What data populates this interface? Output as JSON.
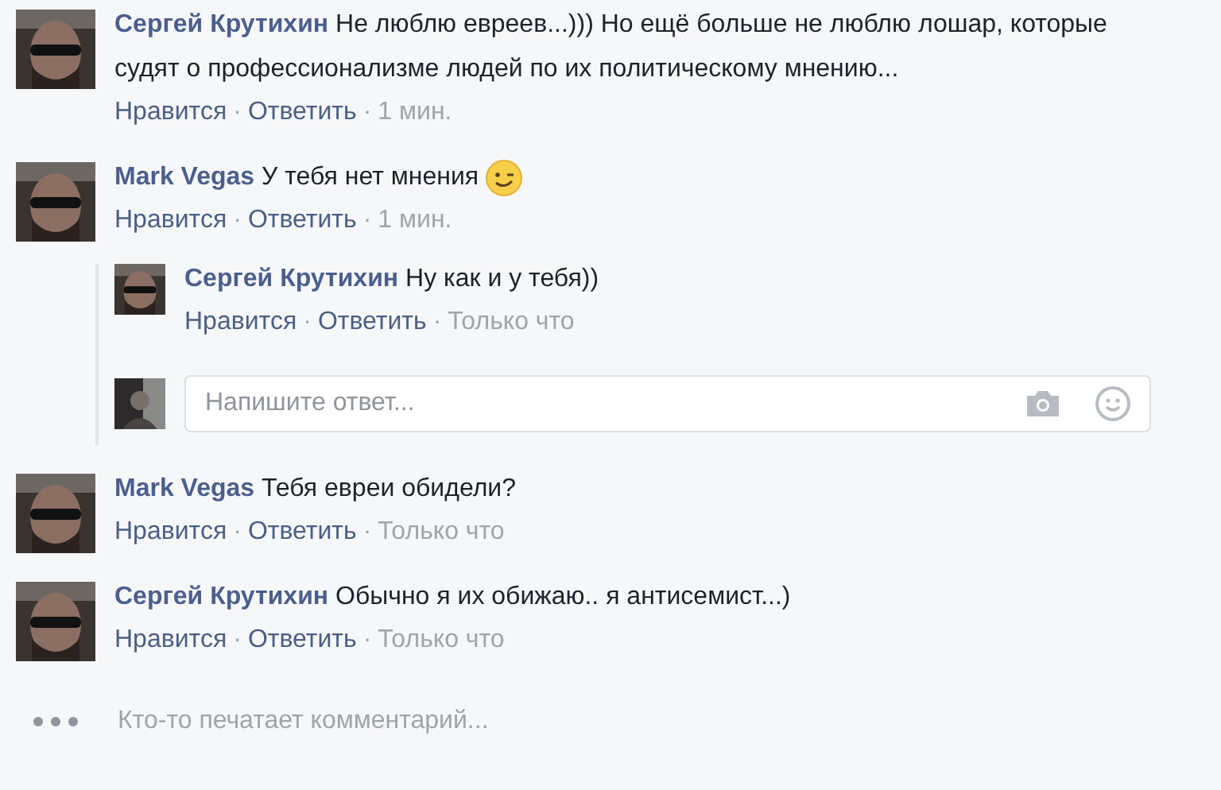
{
  "separator": "·",
  "comments": [
    {
      "author": "Сергей Крутихин",
      "text": "Не люблю евреев...))) Но ещё больше не люблю лошар, которые судят о профессионализме людей по их политическому мнению...",
      "emoji": false,
      "actions": [
        "Нравится",
        "Ответить"
      ],
      "time": "1 мин."
    },
    {
      "author": "Mark Vegas",
      "text": "У тебя нет мнения",
      "emoji": true,
      "actions": [
        "Нравится",
        "Ответить"
      ],
      "time": "1 мин.",
      "replies": [
        {
          "author": "Сергей Крутихин",
          "text": "Ну как и у тебя))",
          "emoji": false,
          "actions": [
            "Нравится",
            "Ответить"
          ],
          "time": "Только что"
        }
      ],
      "reply_field": {
        "placeholder": "Напишите ответ..."
      }
    },
    {
      "author": "Mark Vegas",
      "text": "Тебя евреи обидели?",
      "emoji": false,
      "actions": [
        "Нравится",
        "Ответить"
      ],
      "time": "Только что"
    },
    {
      "author": "Сергей Крутихин",
      "text": "Обычно я их обижаю.. я антисемист...)",
      "emoji": false,
      "actions": [
        "Нравится",
        "Ответить"
      ],
      "time": "Только что"
    }
  ],
  "typing": {
    "text": "Кто-то печатает комментарий..."
  }
}
